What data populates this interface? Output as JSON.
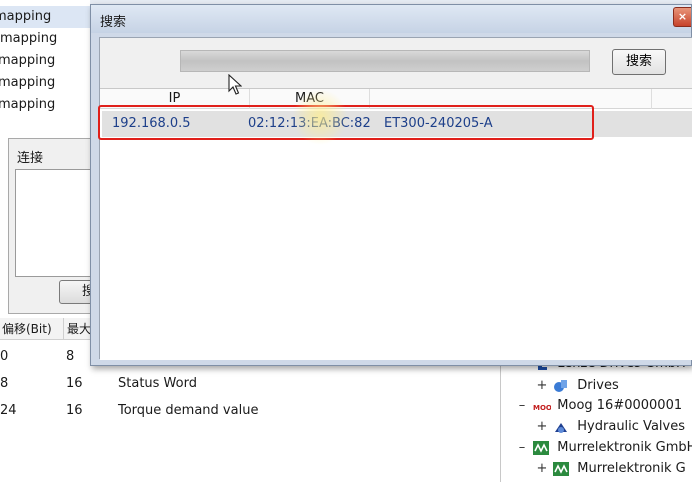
{
  "background": {
    "mapping_items": [
      "mapping",
      "mapping",
      "mapping",
      "mapping",
      "mapping"
    ],
    "connect_dialog": {
      "title": "连接",
      "button_label": "搜"
    },
    "columns": {
      "offset": "偏移(Bit)",
      "max": "最大"
    },
    "rows": [
      {
        "offset": "0",
        "size": "8",
        "name": ""
      },
      {
        "offset": "8",
        "size": "16",
        "name": "Status Word"
      },
      {
        "offset": "24",
        "size": "16",
        "name": "Torque demand value"
      }
    ],
    "tree": [
      {
        "toggle": "–",
        "label": "Lenze Drives GmbH"
      },
      {
        "toggle": "+",
        "label": "Drives"
      },
      {
        "toggle": "–",
        "label": "Moog  16#0000001"
      },
      {
        "toggle": "+",
        "label": "Hydraulic Valves"
      },
      {
        "toggle": "–",
        "label": "Murrelektronik GmbH"
      },
      {
        "toggle": "+",
        "label": "Murrelektronik G"
      }
    ]
  },
  "search_dialog": {
    "title": "搜索",
    "close_symbol": "×",
    "progress": 1.0,
    "search_button_label": "搜索",
    "columns": [
      "IP",
      "MAC",
      ""
    ],
    "results": [
      {
        "ip": "192.168.0.5",
        "mac": "02:12:13:EA:BC:82",
        "name": "ET300-240205-A"
      }
    ],
    "colors": {
      "highlight_border": "#e0201b",
      "result_text": "#1d3f8a"
    }
  }
}
